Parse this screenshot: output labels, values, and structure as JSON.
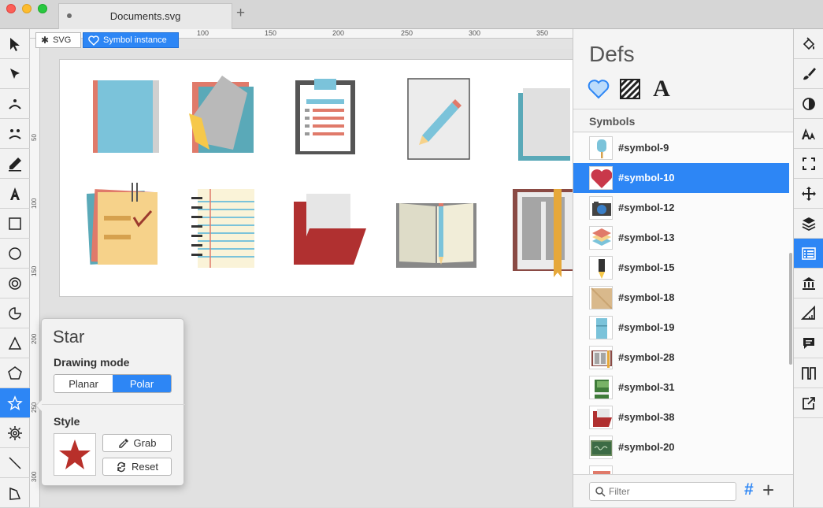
{
  "window": {
    "tab_title": "Documents.svg",
    "new_tab": "+"
  },
  "breadcrumb": {
    "root": "SVG",
    "current": "Symbol instance"
  },
  "ruler": {
    "top": [
      "100",
      "150",
      "200",
      "250",
      "300",
      "350"
    ],
    "left": [
      "50",
      "100",
      "150",
      "200",
      "250",
      "300"
    ]
  },
  "defs_panel": {
    "title": "Defs",
    "section": "Symbols",
    "tabs": [
      "heart-icon",
      "hatch-pattern-icon",
      "font-icon"
    ],
    "font_tab_glyph": "A",
    "symbols": [
      {
        "label": "#symbol-9"
      },
      {
        "label": "#symbol-10"
      },
      {
        "label": "#symbol-12"
      },
      {
        "label": "#symbol-13"
      },
      {
        "label": "#symbol-15"
      },
      {
        "label": "#symbol-18"
      },
      {
        "label": "#symbol-19"
      },
      {
        "label": "#symbol-28"
      },
      {
        "label": "#symbol-31"
      },
      {
        "label": "#symbol-38"
      },
      {
        "label": "#symbol-20"
      }
    ],
    "selected_symbol": "#symbol-10",
    "filter_placeholder": "Filter",
    "hash_button": "#",
    "add_button": "+"
  },
  "star_popover": {
    "title": "Star",
    "drawing_mode_label": "Drawing mode",
    "modes": [
      "Planar",
      "Polar"
    ],
    "active_mode": "Polar",
    "style_label": "Style",
    "grab_label": "Grab",
    "reset_label": "Reset",
    "star_color": "#b8302a"
  },
  "colors": {
    "accent": "#2d86f5",
    "selection": "#2d86f5"
  }
}
